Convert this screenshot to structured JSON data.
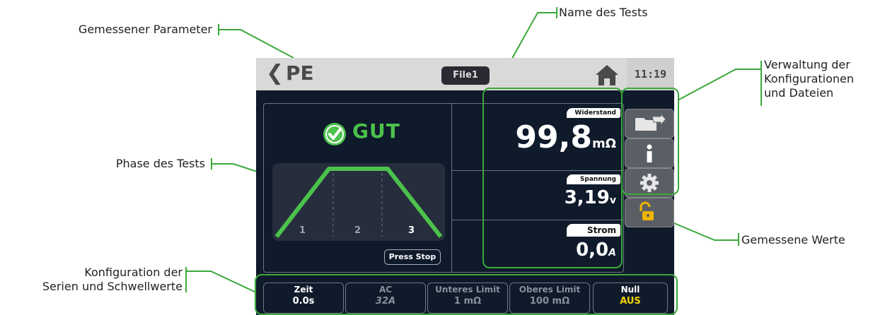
{
  "callouts": {
    "parameter": "Gemessener Parameter",
    "test_name": "Name des Tests",
    "config_files": [
      "Verwaltung der",
      "Konfigurationen",
      "und Dateien"
    ],
    "phase": "Phase des Tests",
    "measured_values": "Gemessene Werte",
    "series_config": [
      "Konfiguration der",
      "Serien und Schwellwerte"
    ]
  },
  "screen": {
    "title": "PE",
    "file": "File1",
    "time": "11:19",
    "status": "GUT",
    "phases": [
      "1",
      "2",
      "3"
    ],
    "press_stop": "Press Stop",
    "measurements": [
      {
        "label": "Widerstand",
        "value": "99,8",
        "unit": "mΩ"
      },
      {
        "label": "Spannung",
        "value": "3,19",
        "unit": "v"
      },
      {
        "label": "Strom",
        "value": "0,0",
        "unit": "A"
      }
    ],
    "bottom": [
      {
        "label": "Zeit",
        "value": "0.0s"
      },
      {
        "label": "AC",
        "value": "32A"
      },
      {
        "label": "Unteres Limit",
        "value": "1 mΩ"
      },
      {
        "label": "Oberes Limit",
        "value": "100 mΩ"
      },
      {
        "label": "Null",
        "value": "AUS"
      }
    ],
    "side_buttons": [
      "folder-export-icon",
      "info-icon",
      "gear-icon",
      "unlock-icon"
    ]
  },
  "colors": {
    "accent_green": "#3aa83a",
    "status_green": "#4cc24c",
    "screen_bg": "#0f1a2b",
    "null_value": "#f5d000"
  }
}
